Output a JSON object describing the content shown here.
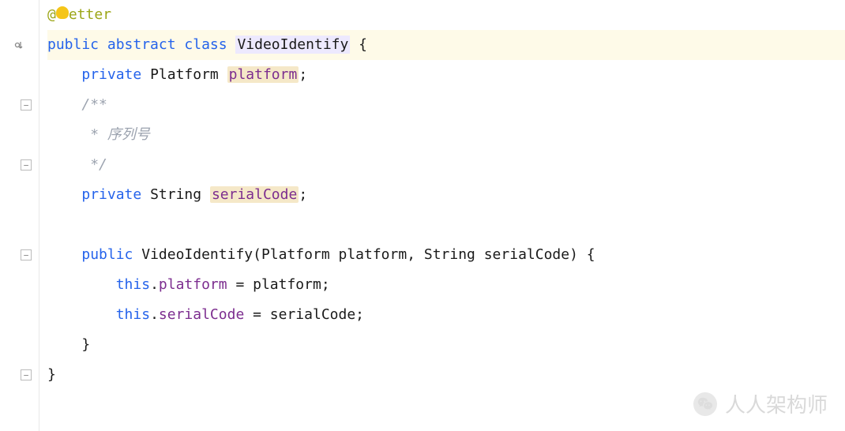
{
  "annotation": {
    "prefix": "@",
    "name": "etter"
  },
  "class_decl": {
    "kw_public": "public",
    "kw_abstract": "abstract",
    "kw_class": "class",
    "name": "VideoIdentify",
    "brace": " {"
  },
  "field1": {
    "kw_private": "private",
    "type": "Platform",
    "name": "platform",
    "semi": ";"
  },
  "comment": {
    "open": "/**",
    "body": " * 序列号",
    "close": " */"
  },
  "field2": {
    "kw_private": "private",
    "type": "String",
    "name": "serialCode",
    "semi": ";"
  },
  "ctor": {
    "kw_public": "public",
    "name": "VideoIdentify",
    "params": "(Platform platform, String serialCode) {"
  },
  "assign1": {
    "kw_this": "this",
    "dot": ".",
    "lhs": "platform",
    "eq": " = ",
    "rhs": "platform;"
  },
  "assign2": {
    "kw_this": "this",
    "dot": ".",
    "lhs": "serialCode",
    "eq": " = ",
    "rhs": "serialCode;"
  },
  "close_inner": "}",
  "close_outer": "}",
  "watermark": "人人架构师"
}
